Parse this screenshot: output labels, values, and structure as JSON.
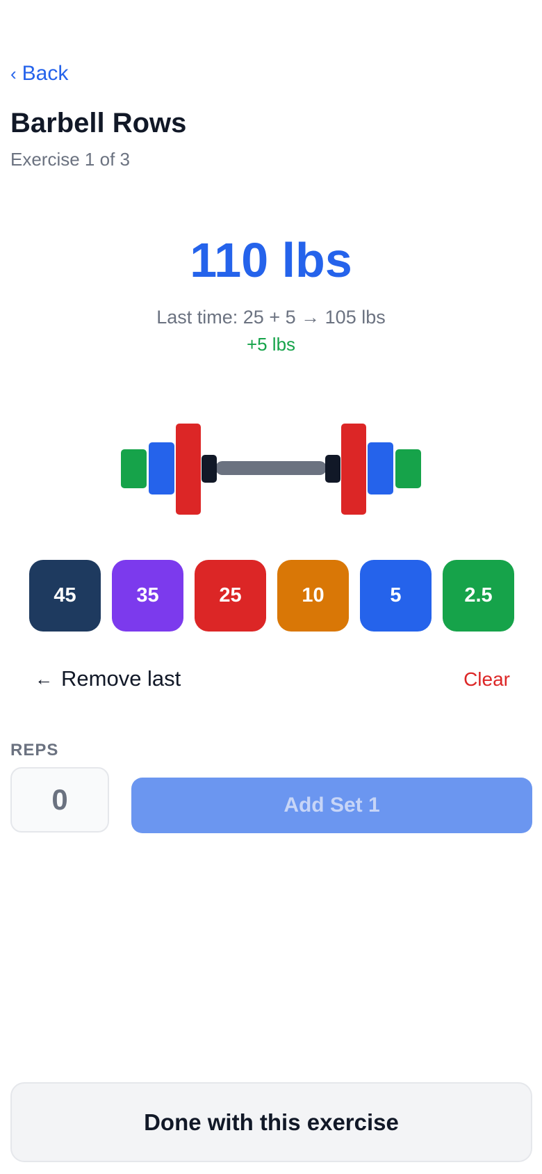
{
  "nav": {
    "back_label": "Back",
    "back_icon": "chevron-left-icon"
  },
  "exercise": {
    "title": "Barbell Rows",
    "progress_text": "Exercise 1 of 3"
  },
  "weight": {
    "display": "110 lbs",
    "last_time_prefix": "Last time: 25 + 5",
    "last_time_arrow": "→",
    "last_time_total": "105 lbs",
    "delta": "+5 lbs"
  },
  "barbell": {
    "plates_loaded_per_side": [
      25,
      5,
      2.5
    ],
    "colors": {
      "25": "#dc2626",
      "5": "#2563eb",
      "2.5": "#16a34a",
      "bar": "#6b7280",
      "collar": "#111827"
    }
  },
  "plate_buttons": [
    {
      "label": "45",
      "color": "#1e3a5f"
    },
    {
      "label": "35",
      "color": "#7c3aed"
    },
    {
      "label": "25",
      "color": "#dc2626"
    },
    {
      "label": "10",
      "color": "#d97706"
    },
    {
      "label": "5",
      "color": "#2563eb"
    },
    {
      "label": "2.5",
      "color": "#16a34a"
    }
  ],
  "actions": {
    "remove_last_label": "Remove last",
    "remove_last_icon": "arrow-left-icon",
    "clear_label": "Clear"
  },
  "reps": {
    "label": "REPS",
    "value": "0",
    "add_set_label": "Add Set 1"
  },
  "footer": {
    "done_label": "Done with this exercise"
  }
}
